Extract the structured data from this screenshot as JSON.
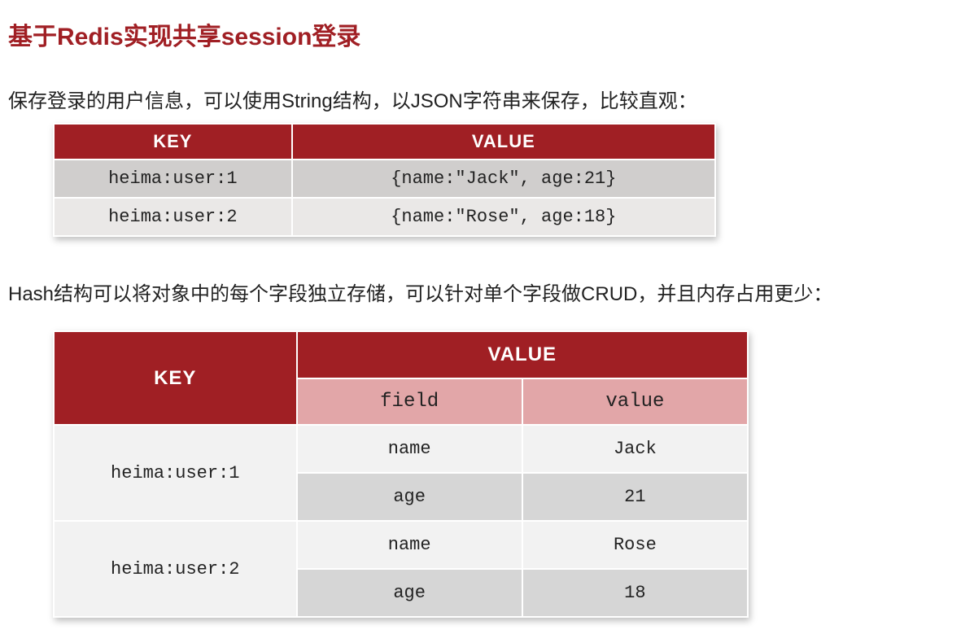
{
  "heading": "基于Redis实现共享session登录",
  "desc1": "保存登录的用户信息，可以使用String结构，以JSON字符串来保存，比较直观：",
  "desc2": "Hash结构可以将对象中的每个字段独立存储，可以针对单个字段做CRUD，并且内存占用更少：",
  "string_table": {
    "head_key": "KEY",
    "head_value": "VALUE",
    "rows": [
      {
        "key": "heima:user:1",
        "value": "{name:\"Jack\", age:21}"
      },
      {
        "key": "heima:user:2",
        "value": "{name:\"Rose\", age:18}"
      }
    ]
  },
  "hash_table": {
    "head_key": "KEY",
    "head_value": "VALUE",
    "sub_field": "field",
    "sub_value": "value",
    "groups": [
      {
        "key": "heima:user:1",
        "pairs": [
          {
            "field": "name",
            "value": "Jack"
          },
          {
            "field": "age",
            "value": "21"
          }
        ]
      },
      {
        "key": "heima:user:2",
        "pairs": [
          {
            "field": "name",
            "value": "Rose"
          },
          {
            "field": "age",
            "value": "18"
          }
        ]
      }
    ]
  }
}
